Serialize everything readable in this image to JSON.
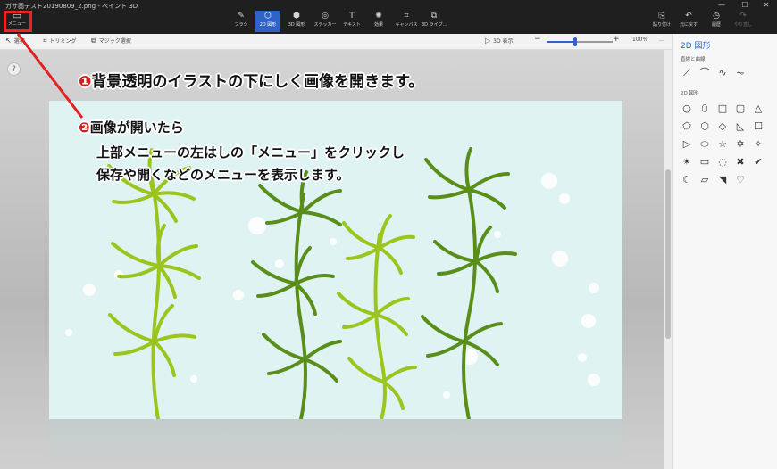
{
  "app": {
    "title": "ガサ画テスト20190809_2.png - ペイント 3D",
    "menu_label": "メニュー",
    "menu_glyph": "▭"
  },
  "toolbar": [
    {
      "label": "ブラシ",
      "glyph": "✎"
    },
    {
      "label": "2D 図形",
      "glyph": "⬡"
    },
    {
      "label": "3D 図形",
      "glyph": "⬢"
    },
    {
      "label": "ステッカー",
      "glyph": "◎"
    },
    {
      "label": "テキスト",
      "glyph": "T"
    },
    {
      "label": "効果",
      "glyph": "✺"
    },
    {
      "label": "キャンバス",
      "glyph": "⌗"
    },
    {
      "label": "3D ライブ...",
      "glyph": "⧉"
    }
  ],
  "toolbar_right": [
    {
      "label": "貼り付け",
      "glyph": "⎘"
    },
    {
      "label": "元に戻す",
      "glyph": "↶"
    },
    {
      "label": "履歴",
      "glyph": "◷"
    },
    {
      "label": "やり直し",
      "glyph": "↷"
    }
  ],
  "window_controls": {
    "minimize": "—",
    "maximize": "☐",
    "close": "✕"
  },
  "subbar": {
    "select": "選択",
    "crop": "トリミング",
    "magic": "マジック選択",
    "view3d": "3D 表示",
    "zoom_out": "−",
    "zoom_in": "+",
    "zoom": "100%",
    "zoom_level": 0.43,
    "more": "…"
  },
  "help": "?",
  "right_panel": {
    "title": "2D 図形",
    "lines_label": "直線と曲線",
    "line_shapes": [
      "⟋",
      "⌒",
      "∿",
      "⏦"
    ],
    "shapes_label": "2D 図形",
    "shapes": [
      "○",
      "⬯",
      "□",
      "▢",
      "△",
      "⬠",
      "⬡",
      "◇",
      "◺",
      "☐",
      "▷",
      "⬭",
      "☆",
      "✡",
      "✧",
      "✴",
      "▭",
      "◌",
      "✖",
      "✔",
      "☾",
      "▱",
      "◥",
      "♡"
    ]
  },
  "annotations": {
    "step1_num": "❶",
    "step1": "背景透明のイラストの下にしく画像を開きます。",
    "step2_num": "❷",
    "step2_line1": "画像が開いたら",
    "step2_line2": "上部メニューの左はしの「メニュー」をクリックし",
    "step2_line3": "保存や開くなどのメニューを表示します。"
  },
  "colors": {
    "accent": "#2f63c8",
    "annotation_red": "#e22222",
    "canvas_bg": "#dff3f3",
    "seaweed_light": "#9bc41d",
    "seaweed_dark": "#5a8e1a"
  }
}
